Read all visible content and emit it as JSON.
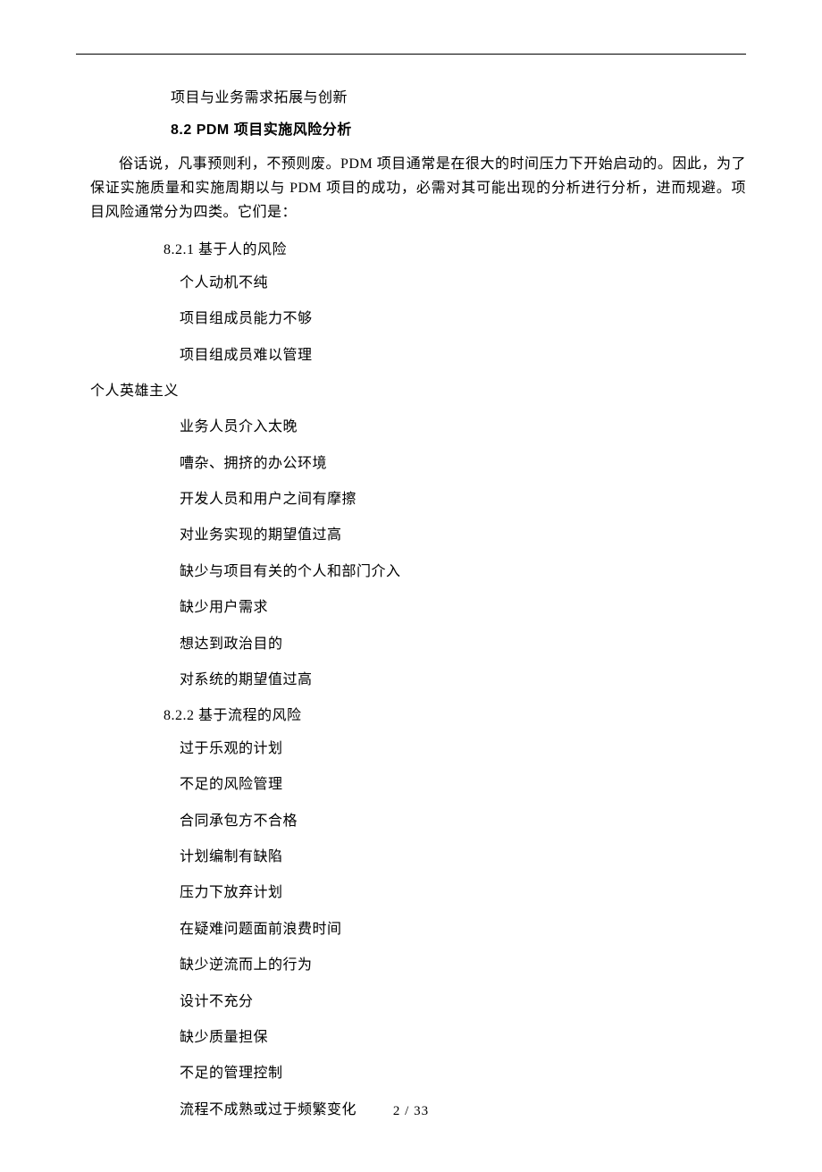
{
  "intro_line": "项目与业务需求拓展与创新",
  "section_heading": "8.2 PDM 项目实施风险分析",
  "body_paragraph": "俗话说，凡事预则利，不预则废。PDM 项目通常是在很大的时间压力下开始启动的。因此，为了保证实施质量和实施周期以与 PDM 项目的成功，必需对其可能出现的分析进行分析，进而规避。项目风险通常分为四类。它们是：",
  "subsection_821": "8.2.1 基于人的风险",
  "list_821": [
    "个人动机不纯",
    "项目组成员能力不够",
    "项目组成员难以管理"
  ],
  "unindented_item": "个人英雄主义",
  "list_821b": [
    "业务人员介入太晚",
    "嘈杂、拥挤的办公环境",
    "开发人员和用户之间有摩擦",
    "对业务实现的期望值过高",
    "缺少与项目有关的个人和部门介入",
    "缺少用户需求",
    "想达到政治目的",
    "对系统的期望值过高"
  ],
  "subsection_822": "8.2.2 基于流程的风险",
  "list_822": [
    "过于乐观的计划",
    "不足的风险管理",
    "合同承包方不合格",
    "计划编制有缺陷",
    "压力下放弃计划",
    "在疑难问题面前浪费时间",
    "缺少逆流而上的行为",
    "设计不充分",
    "缺少质量担保",
    "不足的管理控制",
    "流程不成熟或过于频繁变化"
  ],
  "footer": "2 / 33"
}
